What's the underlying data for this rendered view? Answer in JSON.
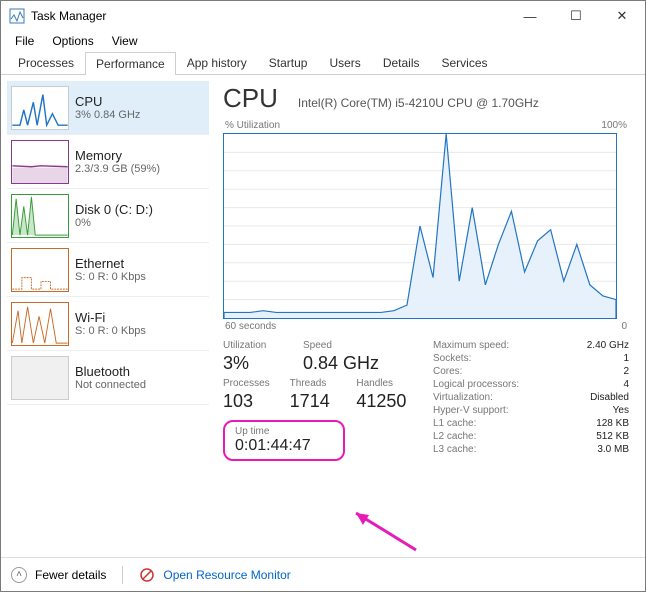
{
  "window": {
    "title": "Task Manager",
    "minimize": "—",
    "maximize": "☐",
    "close": "✕"
  },
  "menu": {
    "file": "File",
    "options": "Options",
    "view": "View"
  },
  "tabs": {
    "processes": "Processes",
    "performance": "Performance",
    "app_history": "App history",
    "startup": "Startup",
    "users": "Users",
    "details": "Details",
    "services": "Services"
  },
  "sidebar": {
    "cpu": {
      "name": "CPU",
      "sub": "3%  0.84 GHz"
    },
    "memory": {
      "name": "Memory",
      "sub": "2.3/3.9 GB (59%)"
    },
    "disk": {
      "name": "Disk 0 (C: D:)",
      "sub": "0%"
    },
    "ethernet": {
      "name": "Ethernet",
      "sub": "S: 0  R: 0 Kbps"
    },
    "wifi": {
      "name": "Wi-Fi",
      "sub": "S: 0  R: 0 Kbps"
    },
    "bluetooth": {
      "name": "Bluetooth",
      "sub": "Not connected"
    }
  },
  "main": {
    "title": "CPU",
    "model": "Intel(R) Core(TM) i5-4210U CPU @ 1.70GHz",
    "graph_label_left": "% Utilization",
    "graph_label_right": "100%",
    "x_left": "60 seconds",
    "x_right": "0",
    "stats": {
      "utilization_label": "Utilization",
      "utilization_value": "3%",
      "speed_label": "Speed",
      "speed_value": "0.84 GHz",
      "processes_label": "Processes",
      "processes_value": "103",
      "threads_label": "Threads",
      "threads_value": "1714",
      "handles_label": "Handles",
      "handles_value": "41250"
    },
    "uptime": {
      "label": "Up time",
      "value": "0:01:44:47"
    },
    "right": {
      "max_speed_l": "Maximum speed:",
      "max_speed_v": "2.40 GHz",
      "sockets_l": "Sockets:",
      "sockets_v": "1",
      "cores_l": "Cores:",
      "cores_v": "2",
      "lprocs_l": "Logical processors:",
      "lprocs_v": "4",
      "virt_l": "Virtualization:",
      "virt_v": "Disabled",
      "hv_l": "Hyper-V support:",
      "hv_v": "Yes",
      "l1_l": "L1 cache:",
      "l1_v": "128 KB",
      "l2_l": "L2 cache:",
      "l2_v": "512 KB",
      "l3_l": "L3 cache:",
      "l3_v": "3.0 MB"
    }
  },
  "footer": {
    "fewer": "Fewer details",
    "resmon": "Open Resource Monitor"
  },
  "chart_data": {
    "type": "line",
    "title": "% Utilization",
    "xlabel": "seconds",
    "ylabel": "%",
    "x": [
      60,
      58,
      56,
      54,
      52,
      50,
      48,
      46,
      44,
      42,
      40,
      38,
      36,
      34,
      32,
      30,
      28,
      26,
      24,
      22,
      20,
      18,
      16,
      14,
      12,
      10,
      8,
      6,
      4,
      2,
      0
    ],
    "values": [
      3,
      3,
      3,
      4,
      3,
      3,
      3,
      3,
      3,
      3,
      3,
      3,
      3,
      4,
      7,
      50,
      22,
      100,
      20,
      60,
      18,
      40,
      58,
      25,
      42,
      48,
      20,
      40,
      18,
      12,
      10
    ],
    "ylim": [
      0,
      100
    ]
  }
}
